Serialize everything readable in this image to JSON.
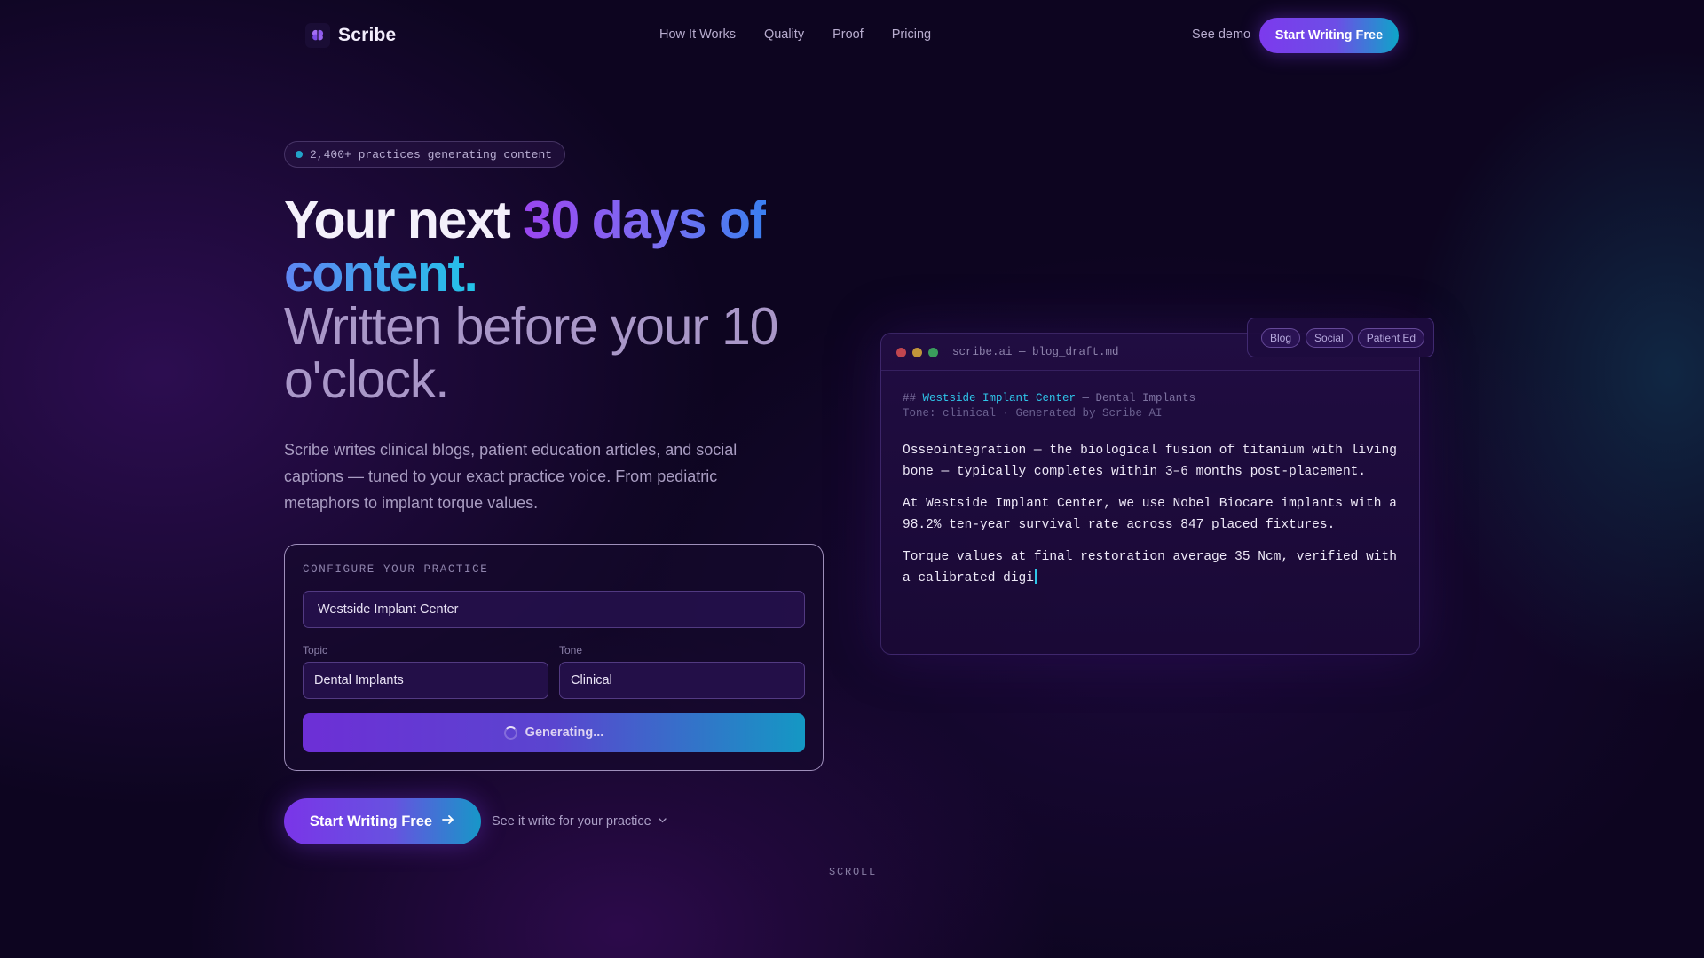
{
  "nav": {
    "brand": "Scribe",
    "links": [
      "How It Works",
      "Quality",
      "Proof",
      "Pricing"
    ],
    "see_demo": "See demo",
    "cta": "Start Writing Free"
  },
  "hero": {
    "badge": "2,400+ practices generating content",
    "headline_part1": "Your next ",
    "headline_highlight1": "30 days of",
    "headline_highlight2": "content.",
    "headline_sub_line1": "Written before your 10",
    "headline_sub_line2": "o'clock.",
    "lead": "Scribe writes clinical blogs, patient education articles, and social captions — tuned to your exact practice voice. From pediatric metaphors to implant torque values."
  },
  "config": {
    "label": "CONFIGURE YOUR PRACTICE",
    "practice_value": "Westside Implant Center",
    "topic_label": "Topic",
    "topic_value": "Dental Implants",
    "tone_label": "Tone",
    "tone_value": "Clinical",
    "generate_label": "Generating..."
  },
  "cta": {
    "primary": "Start Writing Free",
    "secondary": "See it write for your practice",
    "scroll": "SCROLL"
  },
  "editor": {
    "filename": "scribe.ai — blog_draft.md",
    "heading_prefix": "## ",
    "heading_name": "Westside Implant Center",
    "heading_rest": " — Dental Implants",
    "meta": "Tone: clinical · Generated by Scribe AI",
    "paragraphs": [
      "Osseointegration — the biological fusion of titanium with living bone — typically completes within 3–6 months post-placement.",
      "At Westside Implant Center, we use Nobel Biocare implants with a 98.2% ten-year survival rate across 847 placed fixtures.",
      "Torque values at final restoration average 35 Ncm, verified with a calibrated digi"
    ],
    "chips": [
      "Blog",
      "Social",
      "Patient Ed"
    ]
  },
  "colors": {
    "background": "#0d0520",
    "accent_purple": "#7c3aed",
    "accent_cyan": "#0ea5c9",
    "code_highlight": "#2fc6ea"
  },
  "icons": {
    "brand": "brain-icon",
    "cta_arrow": "arrow-right-icon",
    "secondary_chevron": "chevron-down-icon",
    "spinner": "spinner-icon"
  }
}
